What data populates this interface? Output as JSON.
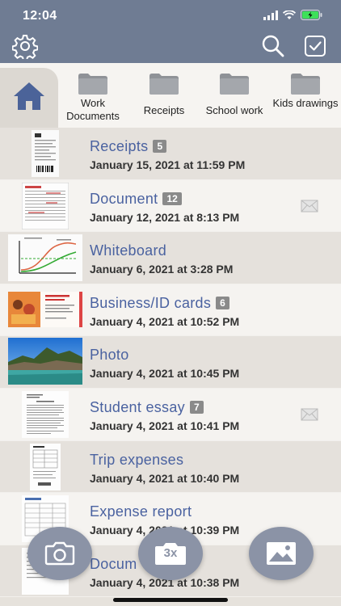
{
  "status_bar": {
    "time": "12:04"
  },
  "colors": {
    "header": "#6f7c93",
    "title_blue": "#4a62a0",
    "badge": "#8a8a8a",
    "fab": "#8b93a6"
  },
  "toolbar": {
    "left_icon": "gear-icon",
    "right_icons": [
      "search-icon",
      "select-checkbox-icon"
    ]
  },
  "folders": [
    {
      "label": "Work Documents"
    },
    {
      "label": "Receipts"
    },
    {
      "label": "School work"
    },
    {
      "label": "Kids drawings"
    }
  ],
  "documents": [
    {
      "title": "Receipts",
      "count": "5",
      "date": "January 15, 2021  at 11:59 PM",
      "mail": false,
      "thumb": "receipt"
    },
    {
      "title": "Document",
      "count": "12",
      "date": "January 12, 2021  at 8:13 PM",
      "mail": true,
      "thumb": "form"
    },
    {
      "title": "Whiteboard",
      "count": "",
      "date": "January 6, 2021  at 3:28 PM",
      "mail": false,
      "thumb": "whiteboard"
    },
    {
      "title": "Business/ID cards",
      "count": "6",
      "date": "January 4, 2021  at 10:52 PM",
      "mail": false,
      "thumb": "card"
    },
    {
      "title": "Photo",
      "count": "",
      "date": "January 4, 2021  at 10:45 PM",
      "mail": false,
      "thumb": "photo"
    },
    {
      "title": "Student essay",
      "count": "7",
      "date": "January 4, 2021  at 10:41 PM",
      "mail": true,
      "thumb": "essay"
    },
    {
      "title": "Trip expenses",
      "count": "",
      "date": "January 4, 2021  at 10:40 PM",
      "mail": false,
      "thumb": "page"
    },
    {
      "title": "Expense report",
      "count": "",
      "date": "January 4, 2021  at 10:39 PM",
      "mail": false,
      "thumb": "page"
    },
    {
      "title": "Docum",
      "count": "",
      "date": "January 4, 2021  at 10:38 PM",
      "mail": false,
      "thumb": "page"
    }
  ],
  "fabs": {
    "camera": "camera-icon",
    "batch": {
      "label": "3x",
      "icon": "batch-camera-icon"
    },
    "gallery": "image-icon"
  }
}
